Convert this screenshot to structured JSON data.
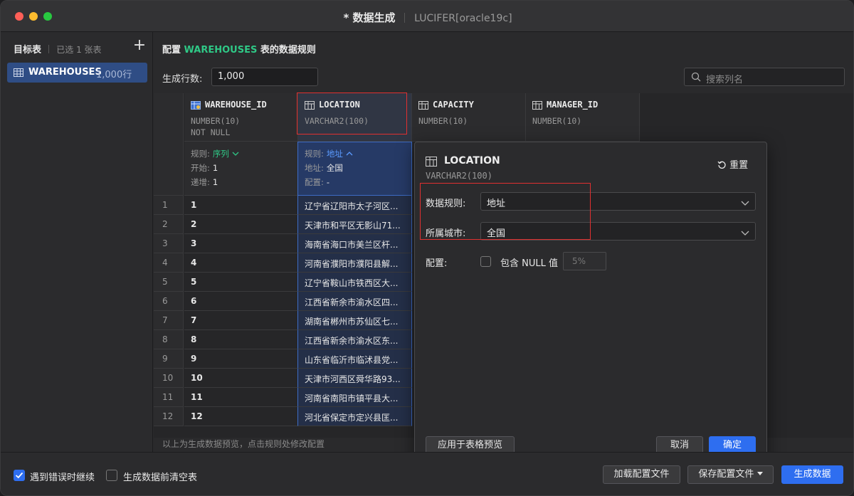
{
  "window": {
    "title": "* 数据生成",
    "connection": "LUCIFER[oracle19c]"
  },
  "sidebar": {
    "heading": "目标表",
    "selected_count": "已选 1 张表",
    "add_label": "+",
    "items": [
      {
        "name": "WAREHOUSES",
        "count": "1,000行"
      }
    ]
  },
  "main": {
    "config_prefix": "配置",
    "config_table": "WAREHOUSES",
    "config_suffix": "表的数据规则",
    "rows_label": "生成行数:",
    "rows_value": "1,000",
    "search_placeholder": "搜索列名",
    "hint": "以上为生成数据预览，点击规则处修改配置",
    "columns": [
      {
        "name": "WAREHOUSE_ID",
        "type": "NUMBER(10)",
        "constraint": "NOT NULL",
        "icon": "key-column-icon",
        "rule_label": "规则:",
        "rule": "序列",
        "l2_label": "开始:",
        "l2": "1",
        "l3_label": "递增:",
        "l3": "1"
      },
      {
        "name": "LOCATION",
        "type": "VARCHAR2(100)",
        "constraint": "",
        "icon": "column-icon",
        "rule_label": "规则:",
        "rule": "地址",
        "l2_label": "地址:",
        "l2": "全国",
        "l3_label": "配置:",
        "l3": "-"
      },
      {
        "name": "CAPACITY",
        "type": "NUMBER(10)",
        "constraint": "",
        "icon": "column-icon"
      },
      {
        "name": "MANAGER_ID",
        "type": "NUMBER(10)",
        "constraint": "",
        "icon": "column-icon"
      }
    ],
    "rows": [
      {
        "idx": "1",
        "id": "1",
        "loc": "辽宁省辽阳市太子河区..."
      },
      {
        "idx": "2",
        "id": "2",
        "loc": "天津市和平区无影山71..."
      },
      {
        "idx": "3",
        "id": "3",
        "loc": "海南省海口市美兰区杆..."
      },
      {
        "idx": "4",
        "id": "4",
        "loc": "河南省濮阳市濮阳县解..."
      },
      {
        "idx": "5",
        "id": "5",
        "loc": "辽宁省鞍山市铁西区大..."
      },
      {
        "idx": "6",
        "id": "6",
        "loc": "江西省新余市渝水区四..."
      },
      {
        "idx": "7",
        "id": "7",
        "loc": "湖南省郴州市苏仙区七..."
      },
      {
        "idx": "8",
        "id": "8",
        "loc": "江西省新余市渝水区东..."
      },
      {
        "idx": "9",
        "id": "9",
        "loc": "山东省临沂市临沭县党..."
      },
      {
        "idx": "10",
        "id": "10",
        "loc": "天津市河西区舜华路93..."
      },
      {
        "idx": "11",
        "id": "11",
        "loc": "河南省南阳市镇平县大..."
      },
      {
        "idx": "12",
        "id": "12",
        "loc": "河北省保定市定兴县匡..."
      }
    ]
  },
  "popover": {
    "column_name": "LOCATION",
    "column_type": "VARCHAR2(100)",
    "reset_label": "重置",
    "rule_label": "数据规则:",
    "rule_value": "地址",
    "city_label": "所属城市:",
    "city_value": "全国",
    "config_label": "配置:",
    "include_null_label": "包含 NULL 值",
    "include_null_checked": false,
    "null_percent": "5%",
    "apply_label": "应用于表格预览",
    "cancel_label": "取消",
    "ok_label": "确定"
  },
  "footer": {
    "continue_on_error_label": "遇到错误时继续",
    "continue_on_error_checked": true,
    "truncate_label": "生成数据前清空表",
    "truncate_checked": false,
    "load_config_label": "加载配置文件",
    "save_config_label": "保存配置文件",
    "generate_label": "生成数据"
  },
  "colors": {
    "accent_blue": "#2e6ef0",
    "accent_green": "#2fc886",
    "highlight_red": "#e03030"
  }
}
